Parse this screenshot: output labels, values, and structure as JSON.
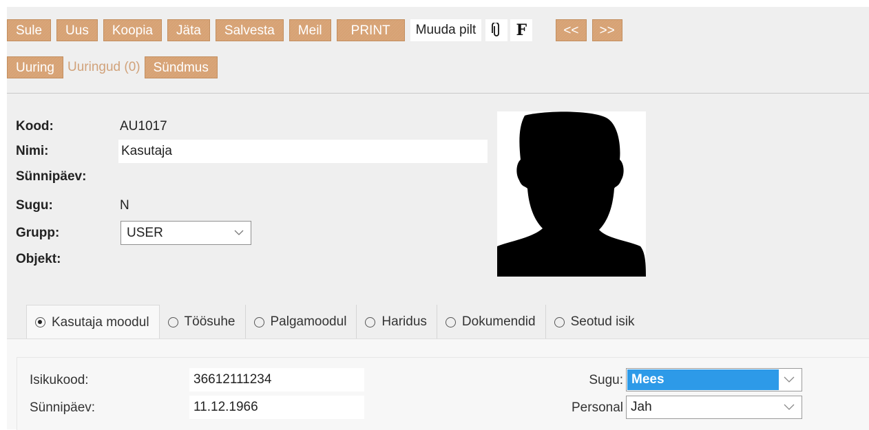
{
  "toolbar": {
    "row1": [
      "Sule",
      "Uus",
      "Koopia",
      "Jäta",
      "Salvesta",
      "Meil",
      "PRINT"
    ],
    "muuda_pilt": "Muuda pilt",
    "f_label": "F",
    "nav_prev": "<<",
    "nav_next": ">>",
    "uuring": "Uuring",
    "uuringud": "Uuringud (0)",
    "syndmus": "Sündmus"
  },
  "header": {
    "kood_label": "Kood:",
    "kood_value": "AU1017",
    "nimi_label": "Nimi:",
    "nimi_value": "Kasutaja",
    "synnipaev_label": "Sünnipäev:",
    "sugu_label": "Sugu:",
    "sugu_value": "N",
    "grupp_label": "Grupp:",
    "grupp_value": "USER",
    "objekt_label": "Objekt:"
  },
  "tabs": [
    {
      "label": "Kasutaja moodul",
      "selected": true
    },
    {
      "label": "Töösuhe",
      "selected": false
    },
    {
      "label": "Palgamoodul",
      "selected": false
    },
    {
      "label": "Haridus",
      "selected": false
    },
    {
      "label": "Dokumendid",
      "selected": false
    },
    {
      "label": "Seotud isik",
      "selected": false
    }
  ],
  "form": {
    "isikukood_label": "Isikukood:",
    "isikukood_value": "36612111234",
    "synnipaev_label": "Sünnipäev:",
    "synnipaev_value": "11.12.1966",
    "sugu_label": "Sugu:",
    "sugu_value": "Mees",
    "personal_label": "Personal",
    "personal_value": "Jah"
  },
  "colors": {
    "button_bg": "#d7a274",
    "selected_highlight": "#2d9ae8"
  },
  "icons": {
    "attachment": "paperclip-icon",
    "dropdown": "chevron-down-icon",
    "photo": "person-silhouette"
  }
}
